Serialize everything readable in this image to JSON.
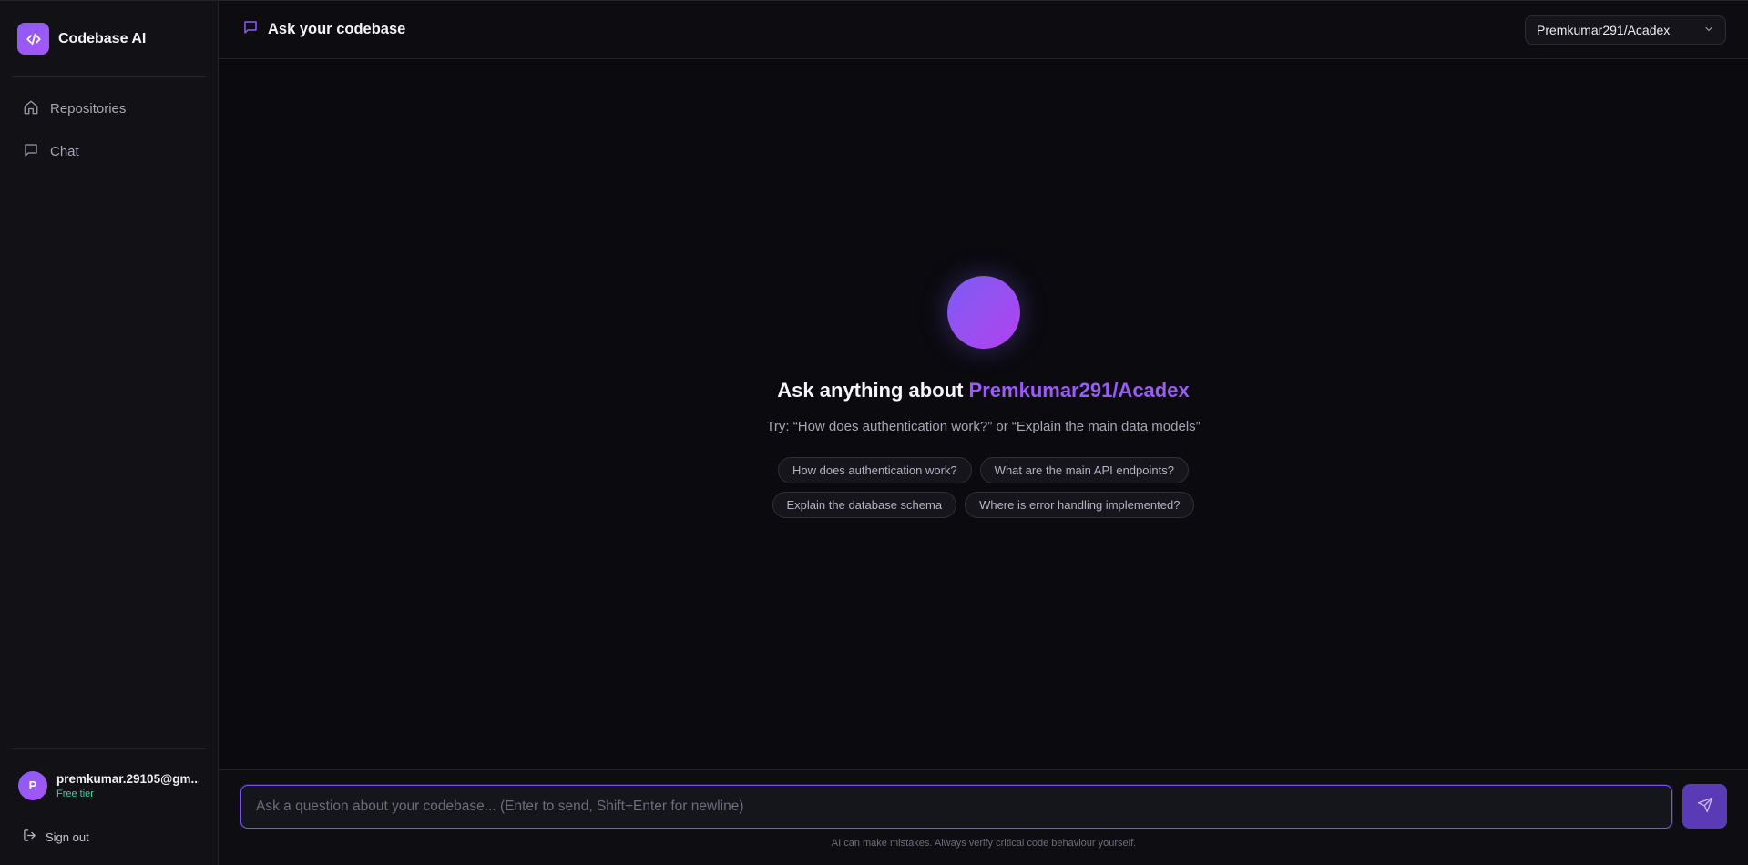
{
  "brand": {
    "name": "Codebase AI"
  },
  "sidebar": {
    "items": [
      {
        "label": "Repositories",
        "icon": "home-icon"
      },
      {
        "label": "Chat",
        "icon": "chat-bubble-icon"
      }
    ]
  },
  "user": {
    "avatar_initial": "P",
    "email": "premkumar.29105@gm...",
    "tier": "Free tier",
    "signout_label": "Sign out"
  },
  "header": {
    "title": "Ask your codebase",
    "selected_repo": "Premkumar291/Acadex"
  },
  "empty_state": {
    "headline_prefix": "Ask anything about",
    "headline_repo": "Premkumar291/Acadex",
    "hint": "Try: “How does authentication work?” or “Explain the main data models”",
    "suggestions_row1": [
      "How does authentication work?",
      "What are the main API endpoints?"
    ],
    "suggestions_row2": [
      "Explain the database schema",
      "Where is error handling implemented?"
    ]
  },
  "composer": {
    "placeholder": "Ask a question about your codebase... (Enter to send, Shift+Enter for newline)",
    "value": "",
    "disclaimer": "AI can make mistakes. Always verify critical code behaviour yourself."
  },
  "colors": {
    "accent": "#8b5cf6",
    "accent_text": "#9b5cf6",
    "tier": "#34d399",
    "background": "#0a0a0f",
    "sidebar": "#111116"
  }
}
